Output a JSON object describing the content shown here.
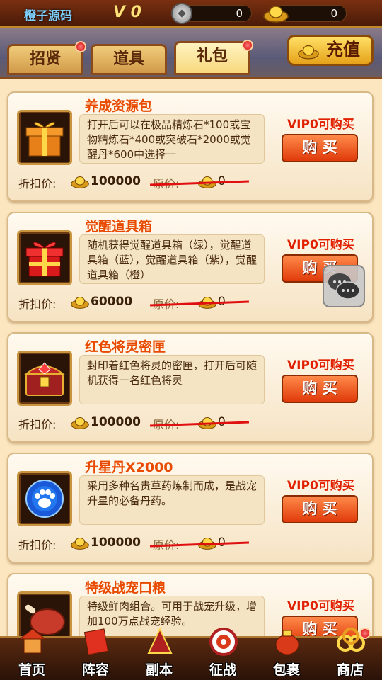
{
  "header": {
    "server_name": "橙子源码",
    "vip_level": "V 0",
    "silver": "0",
    "gold": "0"
  },
  "tabs": [
    {
      "label": "招贤",
      "badge": true
    },
    {
      "label": "道具",
      "badge": false
    },
    {
      "label": "礼包",
      "badge": true,
      "active": true
    }
  ],
  "recharge_label": "充值",
  "price_label": "折扣价:",
  "original_label": "原价:",
  "items": [
    {
      "name": "养成资源包",
      "desc": "打开后可以在极品精炼石*100或宝物精炼石*400或突破石*2000或觉醒丹*600中选择一",
      "vip": "VIP0可购买",
      "buy": "购 买",
      "price": "100000",
      "original": "0",
      "icon": "gift-box-orange-icon"
    },
    {
      "name": "觉醒道具箱",
      "desc": "随机获得觉醒道具箱（绿），觉醒道具箱（蓝），觉醒道具箱（紫），觉醒道具箱（橙）",
      "vip": "VIP0可购买",
      "buy": "购 买",
      "price": "60000",
      "original": "0",
      "icon": "gift-box-red-icon"
    },
    {
      "name": "红色将灵密匣",
      "desc": "封印着红色将灵的密匣，打开后可随机获得一名红色将灵",
      "vip": "VIP0可购买",
      "buy": "购 买",
      "price": "100000",
      "original": "0",
      "icon": "treasure-chest-icon"
    },
    {
      "name": "升星丹X2000",
      "desc": "采用多种名贵草药炼制而成，是战宠升星的必备丹药。",
      "vip": "VIP0可购买",
      "buy": "购 买",
      "price": "100000",
      "original": "0",
      "icon": "paw-orb-icon"
    },
    {
      "name": "特级战宠口粮",
      "desc": "特级鲜肉组合。可用于战宠升级，增加100万点战宠经验。",
      "vip": "VIP0可购买",
      "buy": "购 买",
      "price": "",
      "original": "",
      "icon": "meat-icon"
    }
  ],
  "bottom_nav": [
    {
      "label": "首页",
      "icon": "home-icon"
    },
    {
      "label": "阵容",
      "icon": "lineup-icon"
    },
    {
      "label": "副本",
      "icon": "dungeon-icon"
    },
    {
      "label": "征战",
      "icon": "battle-target-icon"
    },
    {
      "label": "包裹",
      "icon": "bag-icon"
    },
    {
      "label": "商店",
      "icon": "shop-coins-icon",
      "badge": true
    }
  ]
}
